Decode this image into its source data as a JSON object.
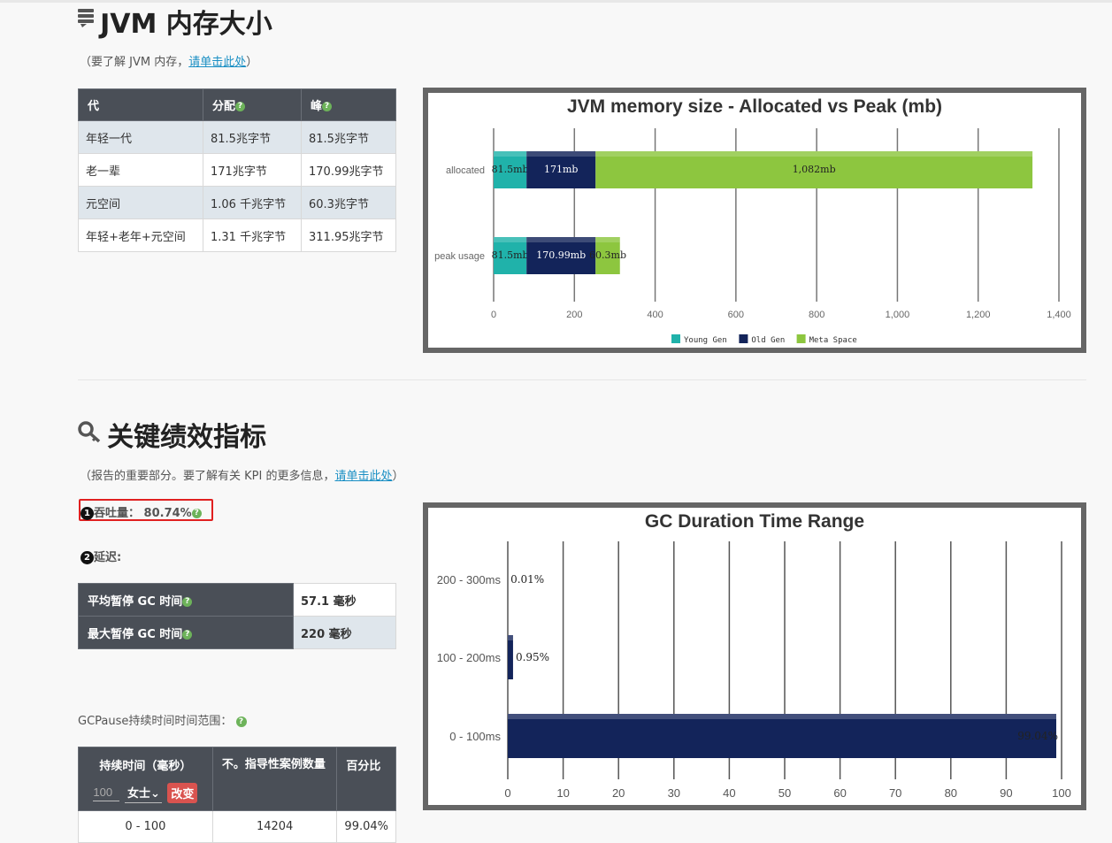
{
  "section1": {
    "title": "JVM 内存大小",
    "subtitle_pre": "（要了解 JVM 内存，",
    "subtitle_link": "请单击此处",
    "subtitle_post": "）",
    "table": {
      "headers": [
        "代",
        "分配",
        "峰"
      ],
      "rows": [
        [
          "年轻一代",
          "81.5兆字节",
          "81.5兆字节"
        ],
        [
          "老一辈",
          "171兆字节",
          "170.99兆字节"
        ],
        [
          "元空间",
          "1.06 千兆字节",
          "60.3兆字节"
        ],
        [
          "年轻+老年+元空间",
          "1.31 千兆字节",
          "311.95兆字节"
        ]
      ]
    }
  },
  "chart1": {
    "chart_data": {
      "type": "bar",
      "orientation": "horizontal",
      "stacked": true,
      "title": "JVM memory size - Allocated vs Peak (mb)",
      "categories": [
        "allocated",
        "peak usage"
      ],
      "series": [
        {
          "name": "Young Gen",
          "values": [
            81.5,
            81.5
          ],
          "labels": [
            "81.5mb",
            "81.5mb"
          ],
          "color": "#20b2aa"
        },
        {
          "name": "Old Gen",
          "values": [
            171,
            170.99
          ],
          "labels": [
            "171mb",
            "170.99mb"
          ],
          "color": "#13245a"
        },
        {
          "name": "Meta Space",
          "values": [
            1082,
            60.3
          ],
          "labels": [
            "1,082mb",
            "60.3mb"
          ],
          "color": "#8dc63f"
        }
      ],
      "xlim": [
        0,
        1400
      ],
      "xticks": [
        "0",
        "200",
        "400",
        "600",
        "800",
        "1,000",
        "1,200",
        "1,400"
      ],
      "grid": true,
      "legend": "bottom"
    }
  },
  "section2": {
    "title": "关键绩效指标",
    "subtitle_pre": "（报告的重要部分。要了解有关 KPI 的更多信息，",
    "subtitle_link": "请单击此处",
    "subtitle_post": "）",
    "throughput_badge": "1",
    "throughput_label": "吞吐量：",
    "throughput_value": "80.74%",
    "latency_badge": "2",
    "latency_label": "延迟:",
    "latency_rows": [
      [
        "平均暂停 GC 时间",
        "57.1 毫秒"
      ],
      [
        "最大暂停 GC 时间",
        "220 毫秒"
      ]
    ],
    "gcpause_label": "GCPause持续时间时间范围：",
    "duration_table": {
      "headers": [
        "持续时间（毫秒）",
        "不。指导性案例数量",
        "百分比"
      ],
      "input_value": "100",
      "select_value": "女士",
      "change_button": "改变",
      "rows": [
        [
          "0 - 100",
          "14204",
          "99.04%"
        ]
      ]
    }
  },
  "chart2": {
    "chart_data": {
      "type": "bar",
      "orientation": "horizontal",
      "title": "GC Duration Time Range",
      "categories": [
        "200 - 300ms",
        "100 - 200ms",
        "0 - 100ms"
      ],
      "values": [
        0.01,
        0.95,
        99.04
      ],
      "labels": [
        "0.01%",
        "0.95%",
        "99.04%"
      ],
      "color": "#13245a",
      "xlim": [
        0,
        100
      ],
      "xticks": [
        "0",
        "10",
        "20",
        "30",
        "40",
        "50",
        "60",
        "70",
        "80",
        "90",
        "100"
      ],
      "grid": true
    }
  }
}
